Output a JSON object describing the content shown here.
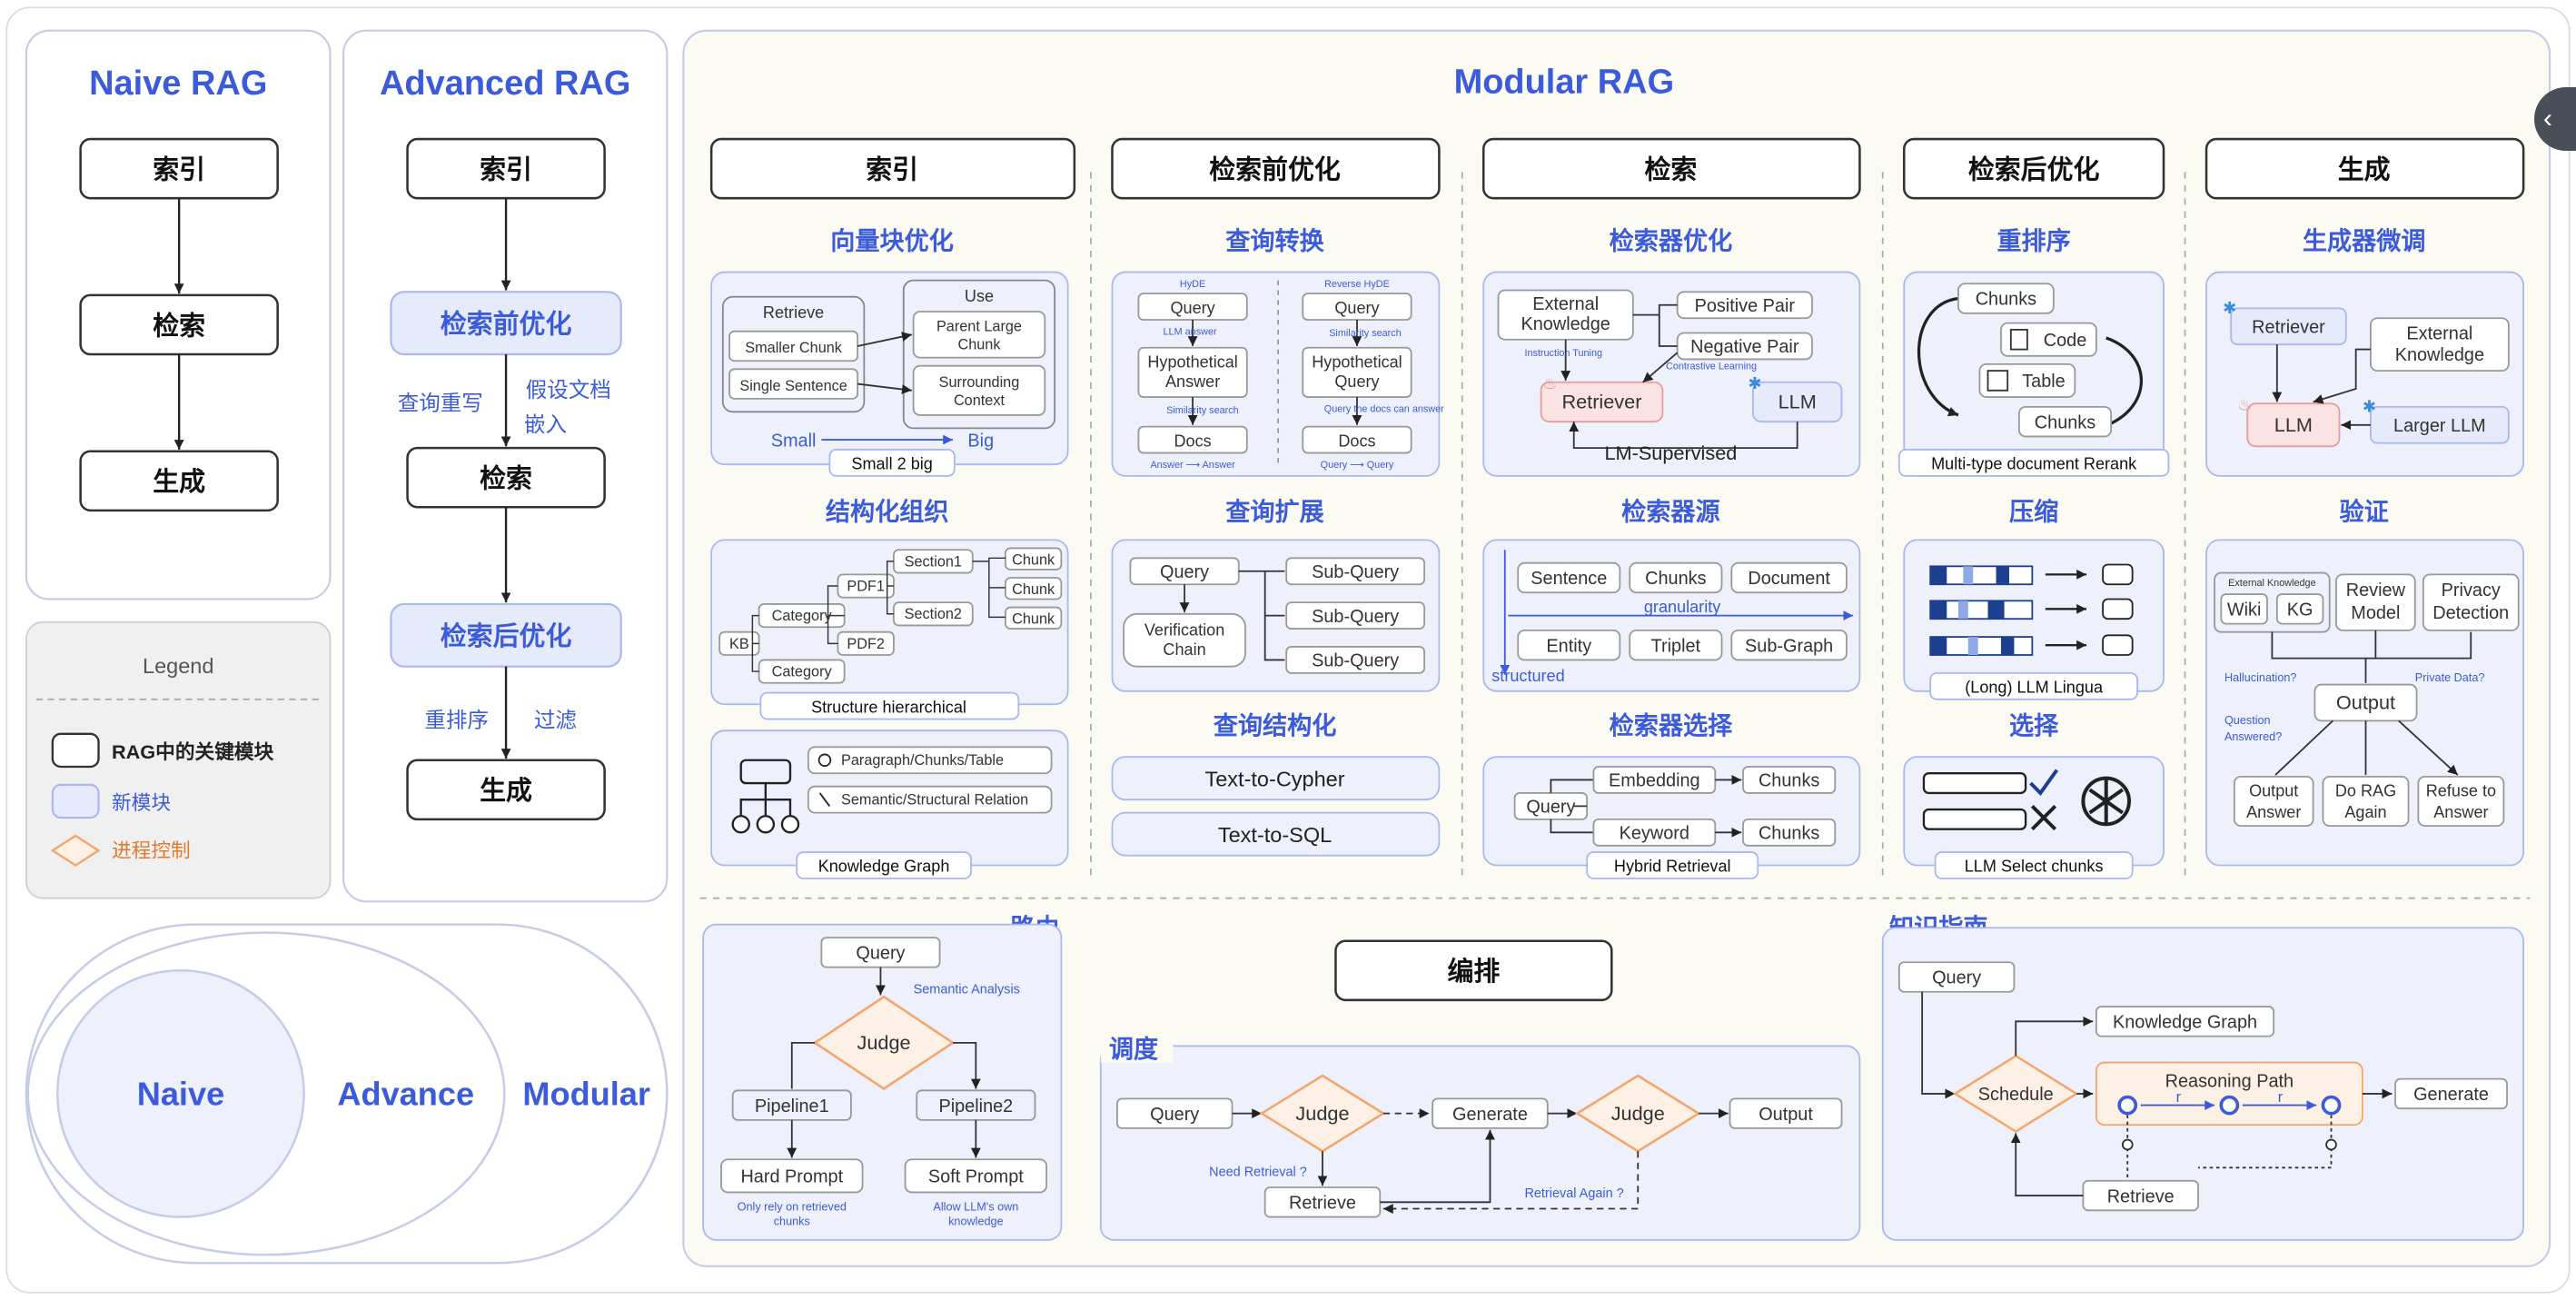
{
  "naive": {
    "title": "Naive RAG",
    "steps": [
      "索引",
      "检索",
      "生成"
    ]
  },
  "advanced": {
    "title": "Advanced RAG",
    "steps": [
      "索引",
      "检索前优化",
      "检索",
      "检索后优化",
      "生成"
    ],
    "notes": [
      "查询重写",
      "假设文档",
      "嵌入",
      "重排序",
      "过滤"
    ]
  },
  "legend": {
    "title": "Legend",
    "items": [
      "RAG中的关键模块",
      "新模块",
      "进程控制"
    ]
  },
  "circles": [
    "Naive",
    "Advance",
    "Modular"
  ],
  "modular": {
    "title": "Modular RAG",
    "columns": [
      "索引",
      "检索前优化",
      "检索",
      "检索后优化",
      "生成"
    ],
    "subtitles": {
      "s1": "向量块优化",
      "s2": "结构化组织",
      "s3": "查询转换",
      "s4": "查询扩展",
      "s5": "查询结构化",
      "s6": "检索器优化",
      "s7": "检索器源",
      "s8": "检索器选择",
      "s9": "重排序",
      "s10": "压缩",
      "s11": "选择",
      "s12": "生成器微调",
      "s13": "验证",
      "s14": "路由",
      "s15": "编排",
      "s16": "调度",
      "s17": "知识指南"
    }
  },
  "small2big": {
    "retrieve": "Retrieve",
    "use": "Use",
    "smaller_chunk": "Smaller Chunk",
    "single_sentence": "Single Sentence",
    "parent_large_chunk": "Parent Large Chunk",
    "surrounding_context": "Surrounding Context",
    "small": "Small",
    "big": "Big",
    "caption": "Small 2 big"
  },
  "hier": {
    "kb": "KB",
    "category": "Category",
    "pdf1": "PDF1",
    "pdf2": "PDF2",
    "section1": "Section1",
    "section2": "Section2",
    "chunk": "Chunk",
    "caption": "Structure hierarchical"
  },
  "kg": {
    "item1": "Paragraph/Chunks/Table",
    "item2": "Semantic/Structural Relation",
    "caption": "Knowledge Graph"
  },
  "hyde": {
    "hyde": "HyDE",
    "reverse": "Reverse HyDE",
    "query": "Query",
    "llm_answer": "LLM answer",
    "hyp_answer": "Hypothetical Answer",
    "similarity": "Similarity search",
    "docs": "Docs",
    "answer_answer": "Answer ⟶ Answer",
    "hyp_query": "Hypothetical Query",
    "query_docs": "Query the docs can answer",
    "query_query": "Query ⟶ Query"
  },
  "expand": {
    "query": "Query",
    "verification": "Verification Chain",
    "sub_query": "Sub-Query"
  },
  "structq": {
    "cypher": "Text-to-Cypher",
    "sql": "Text-to-SQL"
  },
  "retopt": {
    "external": "External Knowledge",
    "positive": "Positive Pair",
    "negative": "Negative Pair",
    "instruction": "Instruction Tuning",
    "contrastive": "Contrastive Learning",
    "retriever": "Retriever",
    "llm": "LLM",
    "supervised": "LM-Supervised"
  },
  "source": {
    "sentence": "Sentence",
    "chunks": "Chunks",
    "document": "Document",
    "granularity": "granularity",
    "entity": "Entity",
    "triplet": "Triplet",
    "subgraph": "Sub-Graph",
    "structured": "structured"
  },
  "hybrid": {
    "embedding": "Embedding",
    "keyword": "Keyword",
    "chunks": "Chunks",
    "query": "Query",
    "caption": "Hybrid Retrieval"
  },
  "rerank": {
    "chunks": "Chunks",
    "code": "Code",
    "table": "Table",
    "caption": "Multi-type document Rerank"
  },
  "compress": {
    "caption": "(Long) LLM Lingua"
  },
  "select": {
    "caption": "LLM Select chunks"
  },
  "finetune": {
    "retriever": "Retriever",
    "external": "External Knowledge",
    "llm": "LLM",
    "larger": "Larger LLM"
  },
  "verify": {
    "ext_knowledge": "External Knowledge",
    "wiki": "Wiki",
    "kg": "KG",
    "review": "Review Model",
    "privacy": "Privacy Detection",
    "hallucination": "Hallucination?",
    "private": "Private Data?",
    "output": "Output",
    "question": "Question Answered?",
    "output_answer": "Output Answer",
    "do_rag": "Do RAG Again",
    "refuse": "Refuse to Answer"
  },
  "routing": {
    "query": "Query",
    "semantic": "Semantic Analysis",
    "judge": "Judge",
    "pipeline1": "Pipeline1",
    "pipeline2": "Pipeline2",
    "hard": "Hard Prompt",
    "soft": "Soft Prompt",
    "hard_note": "Only rely on retrieved chunks",
    "soft_note": "Allow LLM's own knowledge"
  },
  "schedule": {
    "query": "Query",
    "judge": "Judge",
    "generate": "Generate",
    "output": "Output",
    "retrieve": "Retrieve",
    "need": "Need Retrieval ?",
    "again": "Retrieval Again ?"
  },
  "guide": {
    "query": "Query",
    "kg": "Knowledge Graph",
    "schedule": "Schedule",
    "path": "Reasoning Path",
    "r": "r",
    "generate": "Generate",
    "retrieve": "Retrieve"
  }
}
